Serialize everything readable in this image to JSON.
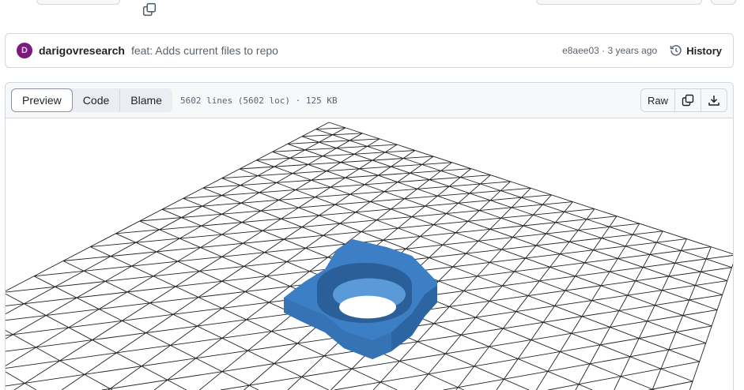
{
  "commit": {
    "author": "darigovresearch",
    "message": "feat: Adds current files to repo",
    "sha": "e8aee03",
    "age": "3 years ago",
    "separator": "·",
    "history_label": "History"
  },
  "file": {
    "tabs": [
      "Preview",
      "Code",
      "Blame"
    ],
    "meta": "5602 lines (5602 loc) · 125 KB",
    "raw_label": "Raw"
  },
  "colors": {
    "model": "#3a7bbf",
    "avatar": "#7a1a7e"
  }
}
